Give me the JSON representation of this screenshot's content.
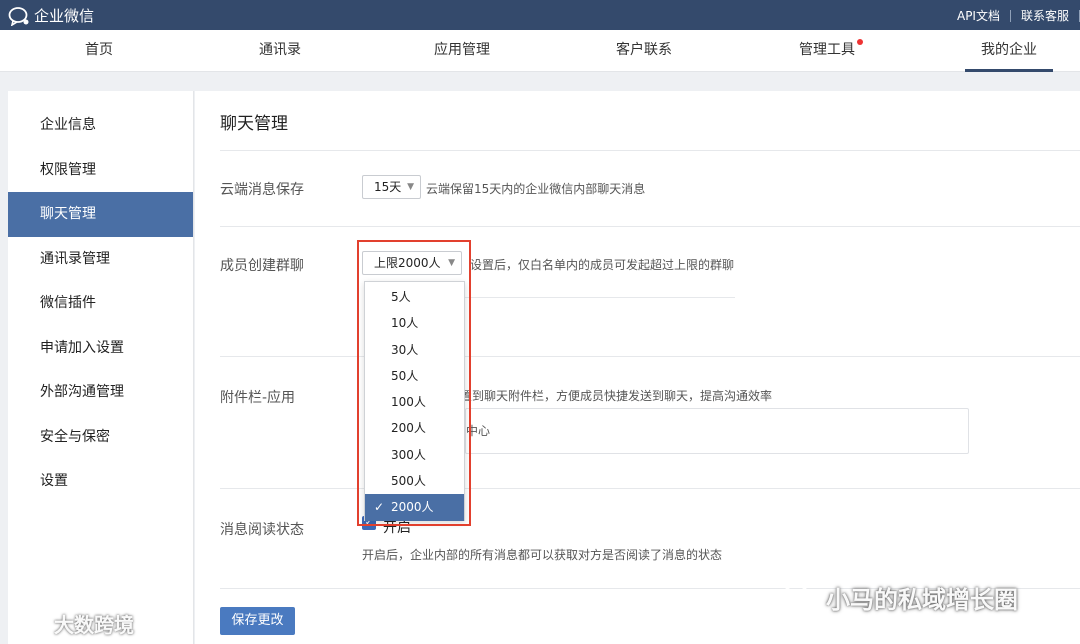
{
  "topbar": {
    "brand": "企业微信",
    "links": [
      "API文档",
      "联系客服"
    ]
  },
  "nav": {
    "items": [
      "首页",
      "通讯录",
      "应用管理",
      "客户联系",
      "管理工具",
      "我的企业"
    ],
    "active": "我的企业"
  },
  "sidebar": {
    "items": [
      "企业信息",
      "权限管理",
      "聊天管理",
      "通讯录管理",
      "微信插件",
      "申请加入设置",
      "外部沟通管理",
      "安全与保密",
      "设置"
    ],
    "active": "聊天管理"
  },
  "main": {
    "title": "聊天管理",
    "cloud_save": {
      "label": "云端消息保存",
      "selected": "15天",
      "hint": "云端保留15天内的企业微信内部聊天消息"
    },
    "group_chat": {
      "label": "成员创建群聊",
      "selected": "上限2000人",
      "hint": "设置后，仅白名单内的成员可发起超过上限的群聊"
    },
    "attachment": {
      "label": "附件栏-应用",
      "hint": "置到聊天附件栏，方便成员快捷发送到聊天，提高沟通效率",
      "box_text": "中心"
    },
    "read_status": {
      "label": "消息阅读状态",
      "checkbox_label": "开启",
      "checked": true,
      "hint": "开启后，企业内部的所有消息都可以获取对方是否阅读了消息的状态"
    },
    "save_button": "保存更改"
  },
  "dropdown": {
    "options": [
      "5人",
      "10人",
      "30人",
      "50人",
      "100人",
      "200人",
      "300人",
      "500人",
      "2000人"
    ],
    "selected": "2000人"
  },
  "watermarks": {
    "left": "大数跨境",
    "right": "小马的私域增长圈"
  },
  "colors": {
    "topbar": "#344a6c",
    "accent": "#4a6fa5",
    "highlight_border": "#e2402e",
    "notification_dot": "#ee3333"
  }
}
